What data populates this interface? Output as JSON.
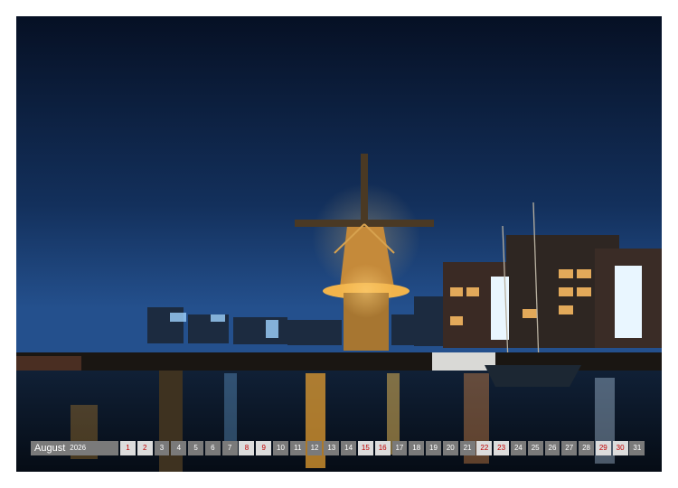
{
  "calendar": {
    "month": "August",
    "year": "2026",
    "days": [
      {
        "d": "1",
        "weekend": true
      },
      {
        "d": "2",
        "weekend": true
      },
      {
        "d": "3",
        "weekend": false
      },
      {
        "d": "4",
        "weekend": false
      },
      {
        "d": "5",
        "weekend": false
      },
      {
        "d": "6",
        "weekend": false
      },
      {
        "d": "7",
        "weekend": false
      },
      {
        "d": "8",
        "weekend": true
      },
      {
        "d": "9",
        "weekend": true
      },
      {
        "d": "10",
        "weekend": false
      },
      {
        "d": "11",
        "weekend": false
      },
      {
        "d": "12",
        "weekend": false
      },
      {
        "d": "13",
        "weekend": false
      },
      {
        "d": "14",
        "weekend": false
      },
      {
        "d": "15",
        "weekend": true
      },
      {
        "d": "16",
        "weekend": true
      },
      {
        "d": "17",
        "weekend": false
      },
      {
        "d": "18",
        "weekend": false
      },
      {
        "d": "19",
        "weekend": false
      },
      {
        "d": "20",
        "weekend": false
      },
      {
        "d": "21",
        "weekend": false
      },
      {
        "d": "22",
        "weekend": true
      },
      {
        "d": "23",
        "weekend": true
      },
      {
        "d": "24",
        "weekend": false
      },
      {
        "d": "25",
        "weekend": false
      },
      {
        "d": "26",
        "weekend": false
      },
      {
        "d": "27",
        "weekend": false
      },
      {
        "d": "28",
        "weekend": false
      },
      {
        "d": "29",
        "weekend": true
      },
      {
        "d": "30",
        "weekend": true
      },
      {
        "d": "31",
        "weekend": false
      }
    ]
  },
  "colors": {
    "sky_top": "#07132a",
    "sky_bottom": "#1f4a86",
    "water": "#0a1420",
    "light": "#f5b53a",
    "weekday_bg": "#7a7a7a",
    "weekend_bg": "#dcdcdc",
    "weekend_text": "#c00000"
  }
}
